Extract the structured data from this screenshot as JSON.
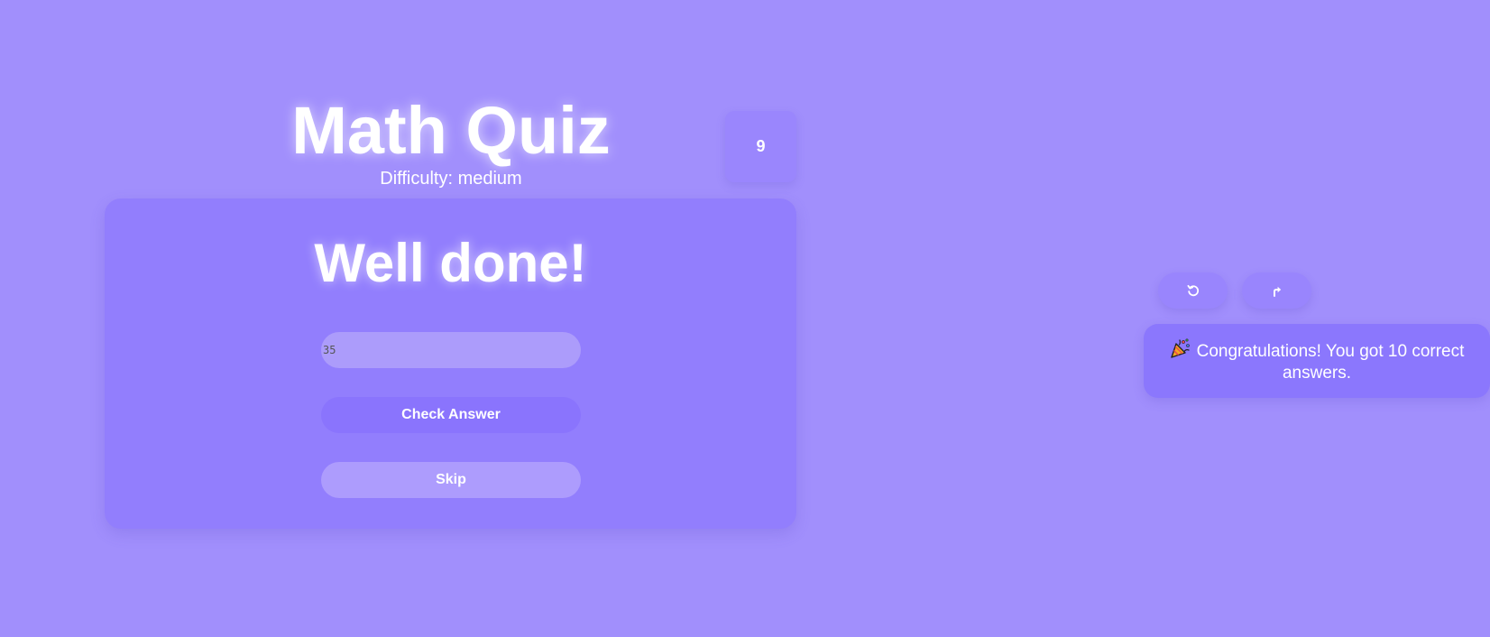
{
  "header": {
    "title": "Math Quiz",
    "difficulty": "Difficulty: medium",
    "score": "9"
  },
  "card": {
    "feedback": "Well done!",
    "answer_value": "35",
    "check_label": "Check Answer",
    "skip_label": "Skip"
  },
  "actions": {
    "restart_icon": "restart-icon",
    "share_icon": "share-icon"
  },
  "toast": {
    "icon": "party-popper-icon",
    "message": "Congratulations! You got 10 correct answers."
  },
  "colors": {
    "background": "#a18ffc",
    "card": "#927efd",
    "primary_button": "#8a74fd",
    "secondary_button": "#ad9cfd",
    "input": "#ac9cfb",
    "text": "#ffffff"
  }
}
